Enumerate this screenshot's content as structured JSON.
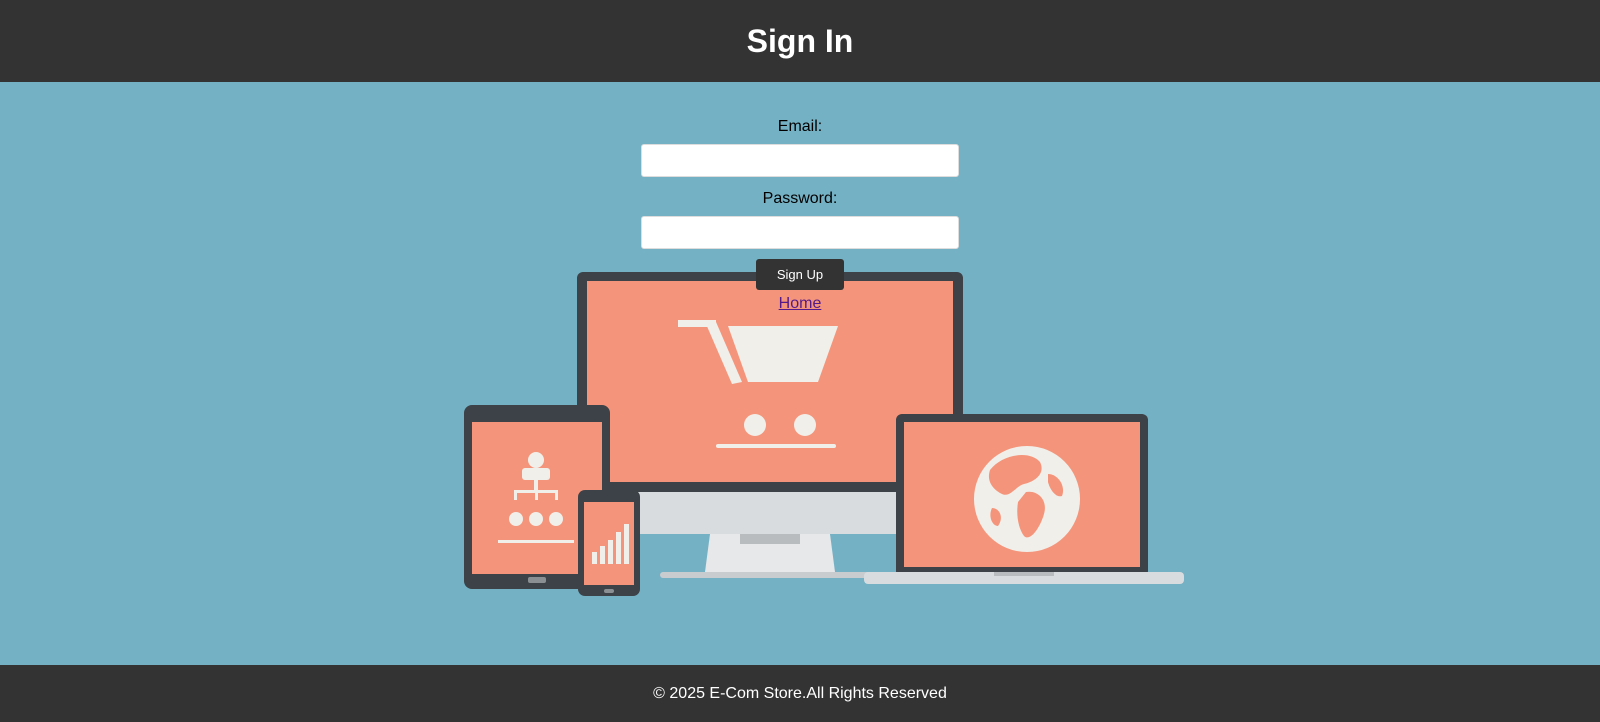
{
  "header": {
    "title": "Sign In"
  },
  "form": {
    "email_label": "Email:",
    "email_value": "",
    "password_label": "Password:",
    "password_value": "",
    "submit_label": "Sign Up",
    "home_link": "Home"
  },
  "hero": {
    "illustration": "responsive-devices-ecommerce-illustration",
    "icons": [
      "shopping-cart-icon",
      "org-chart-icon",
      "bar-chart-icon",
      "globe-icon"
    ]
  },
  "footer": {
    "text": "© 2025 E-Com Store.All Rights Reserved"
  },
  "colors": {
    "bar": "#333333",
    "background": "#75b1c4",
    "screen": "#f4957b",
    "device": "#3c4247",
    "icon": "#f1efea"
  }
}
